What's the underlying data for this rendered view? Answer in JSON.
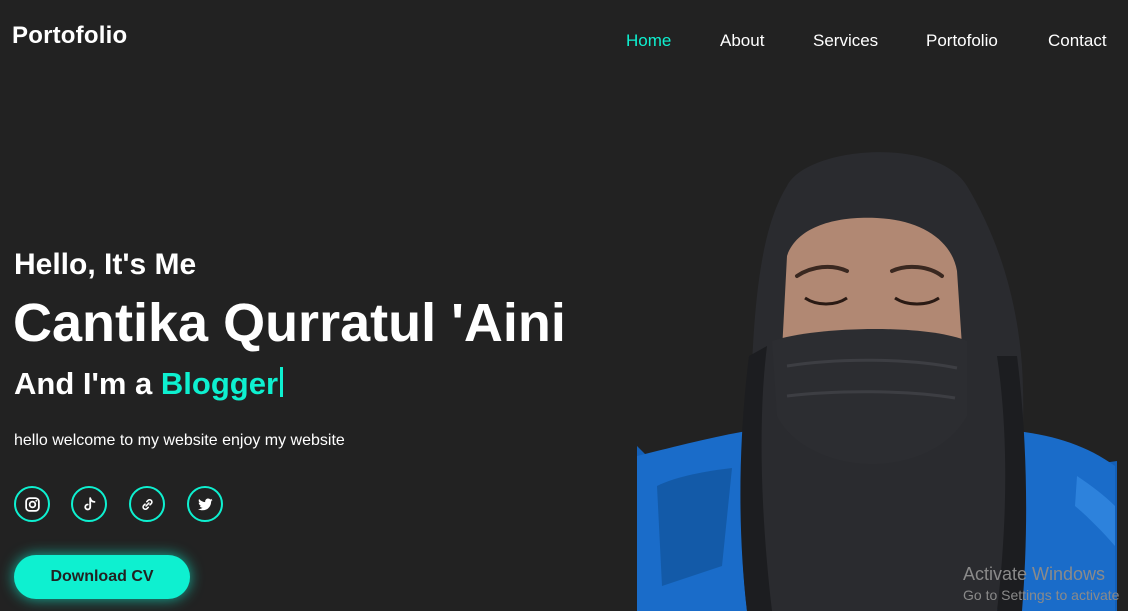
{
  "header": {
    "logo": "Portofolio",
    "nav": [
      {
        "label": "Home",
        "active": true
      },
      {
        "label": "About",
        "active": false
      },
      {
        "label": "Services",
        "active": false
      },
      {
        "label": "Portofolio",
        "active": false
      },
      {
        "label": "Contact",
        "active": false
      }
    ]
  },
  "hero": {
    "greeting": "Hello, It's Me",
    "name": "Cantika Qurratul 'Aini",
    "role_prefix": "And I'm a",
    "role_highlight": "Blogger",
    "description": "hello welcome to my website enjoy my website",
    "socials": [
      {
        "icon": "instagram-icon"
      },
      {
        "icon": "tiktok-icon"
      },
      {
        "icon": "link-icon"
      },
      {
        "icon": "twitter-icon"
      }
    ],
    "cta_label": "Download CV"
  },
  "watermark": {
    "line1": "Activate Windows",
    "line2": "Go to Settings to activate"
  },
  "colors": {
    "background": "#222222",
    "accent": "#0ef0d0",
    "text": "#ffffff"
  }
}
